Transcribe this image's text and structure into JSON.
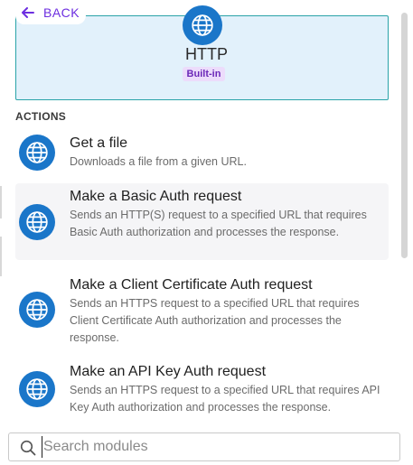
{
  "colors": {
    "accent_purple": "#6d2ee0",
    "icon_blue": "#1a76c9",
    "header_bg": "#e2f1fb",
    "badge_bg": "#ecdcfb"
  },
  "nav": {
    "back_label": "BACK",
    "back_icon": "arrow-left-icon"
  },
  "module": {
    "icon": "globe-icon",
    "title": "HTTP",
    "badge": "Built-in"
  },
  "section": {
    "label": "ACTIONS"
  },
  "actions": [
    {
      "icon": "globe-icon",
      "title": "Get a file",
      "description": "Downloads a file from a given URL."
    },
    {
      "icon": "globe-icon",
      "title": "Make a Basic Auth request",
      "description": "Sends an HTTP(S) request to a specified URL that requires Basic Auth authorization and processes the response."
    },
    {
      "icon": "globe-icon",
      "title": "Make a Client Certificate Auth request",
      "description": "Sends an HTTPS request to a specified URL that requires Client Certificate Auth authorization and processes the response."
    },
    {
      "icon": "globe-icon",
      "title": "Make an API Key Auth request",
      "description": "Sends an HTTPS request to a specified URL that requires API Key Auth authorization and processes the response."
    }
  ],
  "search": {
    "placeholder": "Search modules",
    "value": "",
    "icon": "search-icon"
  }
}
